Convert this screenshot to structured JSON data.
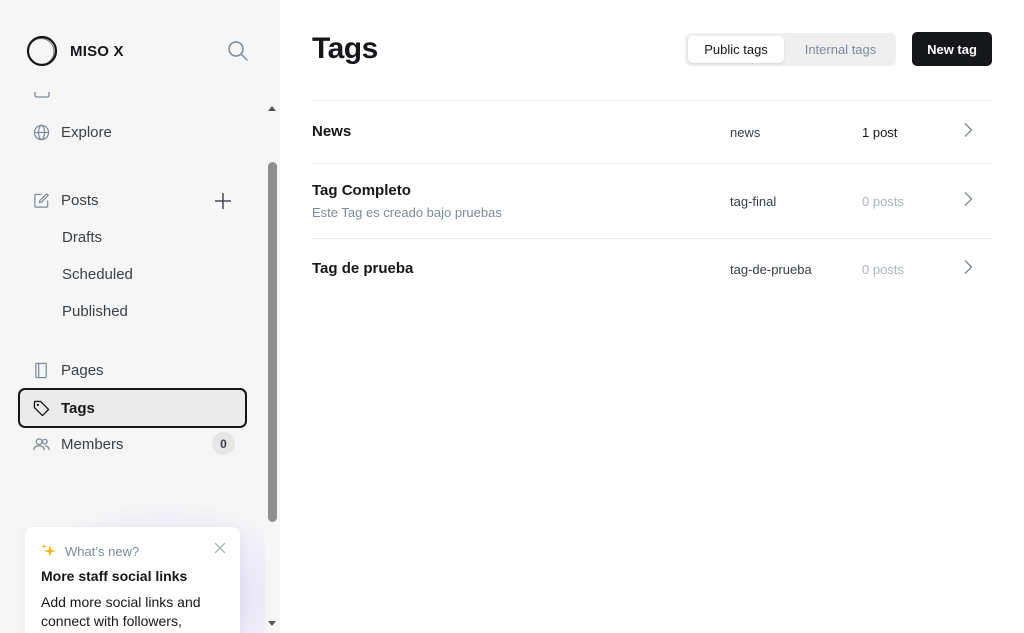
{
  "sidebar": {
    "brand_name": "MISO X",
    "nav": {
      "explore": "Explore",
      "posts": "Posts",
      "drafts": "Drafts",
      "scheduled": "Scheduled",
      "published": "Published",
      "pages": "Pages",
      "tags": "Tags",
      "members": "Members",
      "members_count": "0"
    },
    "whats_new": {
      "label": "What’s new?",
      "title": "More staff social links",
      "text": "Add more social links and connect with followers, wherever they are."
    }
  },
  "header": {
    "title": "Tags",
    "tab_public": "Public tags",
    "tab_internal": "Internal tags",
    "new_tag": "New tag"
  },
  "tags": [
    {
      "name": "News",
      "description": "",
      "slug": "news",
      "count": "1 post"
    },
    {
      "name": "Tag Completo",
      "description": "Este Tag es creado bajo pruebas",
      "slug": "tag-final",
      "count": "0 posts"
    },
    {
      "name": "Tag de prueba",
      "description": "",
      "slug": "tag-de-prueba",
      "count": "0 posts"
    }
  ],
  "colors": {
    "accent_dark": "#15171a",
    "muted": "#7c8b9a",
    "sidebar_bg": "#f6f6f6"
  }
}
